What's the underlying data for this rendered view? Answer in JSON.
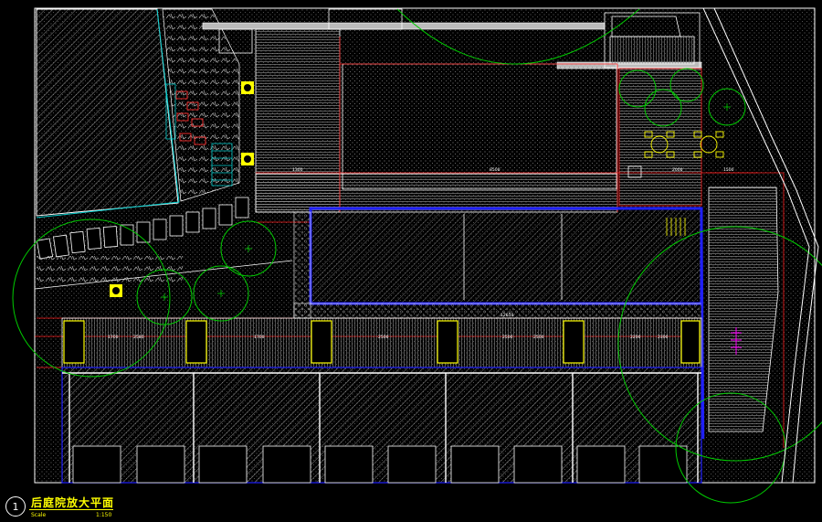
{
  "drawing": {
    "number": "1",
    "title": "后庭院放大平面",
    "scale_label": "Scale",
    "scale_ratio": "1:150"
  },
  "dimensions": {
    "top_row": [
      "1300",
      "8500",
      "2000",
      "1500"
    ],
    "corridor": [
      "1700",
      "2580",
      "1700",
      "2500",
      "2500",
      "2500",
      "2200",
      "2300"
    ],
    "pool_top": "12650"
  },
  "colors": {
    "background": "#000000",
    "wall_line": "#ffffff",
    "dimension_line": "#ff0000",
    "tree_outline": "#00cc00",
    "pool_border": "#2020ff",
    "planter": "#ffff00",
    "accent_cyan": "#00cccc",
    "symbol_magenta": "#ff00ff"
  }
}
